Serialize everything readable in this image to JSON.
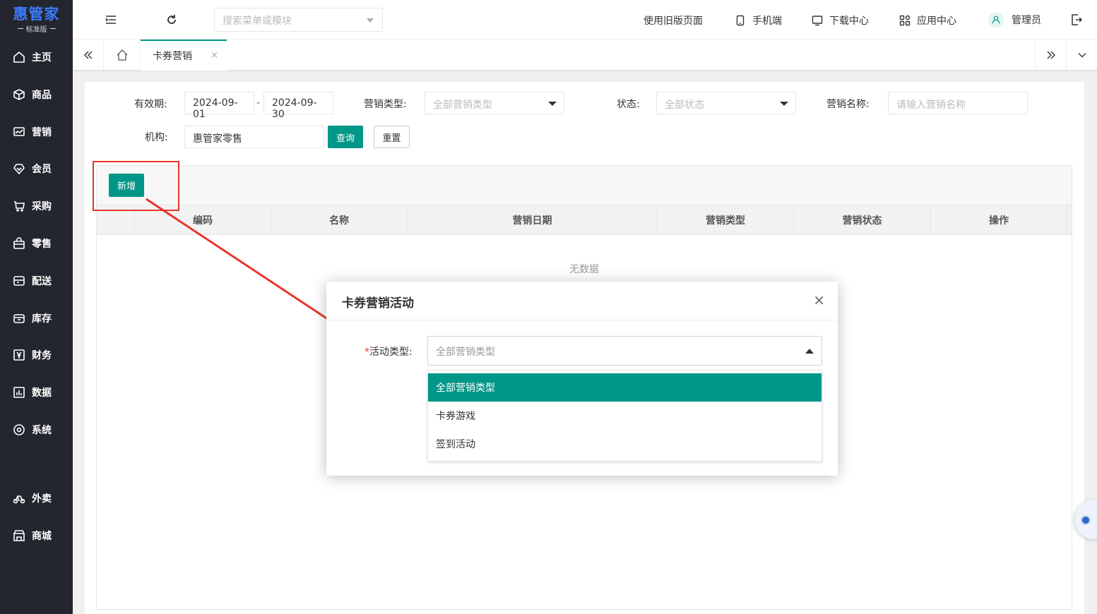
{
  "brand": {
    "name": "惠管家",
    "edition": "标准版",
    "color": "#3b7cff"
  },
  "sidebar": {
    "items": [
      {
        "label": "主页",
        "icon": "home-icon"
      },
      {
        "label": "商品",
        "icon": "cube-icon"
      },
      {
        "label": "营销",
        "icon": "chart-icon"
      },
      {
        "label": "会员",
        "icon": "diamond-icon"
      },
      {
        "label": "采购",
        "icon": "cart-icon"
      },
      {
        "label": "零售",
        "icon": "bag-icon"
      },
      {
        "label": "配送",
        "icon": "truck-icon"
      },
      {
        "label": "库存",
        "icon": "box-icon"
      },
      {
        "label": "财务",
        "icon": "yen-icon"
      },
      {
        "label": "数据",
        "icon": "bar-chart-icon"
      },
      {
        "label": "系统",
        "icon": "settings-icon"
      },
      {
        "label": "外卖",
        "icon": "bike-icon"
      },
      {
        "label": "商城",
        "icon": "store-icon"
      }
    ]
  },
  "header": {
    "search_placeholder": "搜索菜单或模块",
    "links": {
      "old_version": "使用旧版页面",
      "mobile": "手机端",
      "download": "下载中心",
      "apps": "应用中心",
      "user": "管理员"
    }
  },
  "tabs": {
    "active": "卡券营销",
    "close": "×"
  },
  "filters": {
    "validity_label": "有效期:",
    "date_from": "2024-09-01",
    "date_sep": "-",
    "date_to": "2024-09-30",
    "type_label": "营销类型:",
    "type_value": "全部营销类型",
    "status_label": "状态:",
    "status_value": "全部状态",
    "name_label": "营销名称:",
    "name_placeholder": "请输入营销名称",
    "org_label": "机构:",
    "org_value": "惠管家零售",
    "query_button": "查询",
    "reset_button": "重置"
  },
  "table": {
    "add_button": "新增",
    "columns": [
      "编码",
      "名称",
      "营销日期",
      "营销类型",
      "营销状态",
      "操作"
    ],
    "empty_text": "无数据"
  },
  "modal": {
    "title": "卡券营销活动",
    "close": "×",
    "field_required": "*",
    "field_label": "活动类型:",
    "field_placeholder": "全部营销类型",
    "options": [
      "全部营销类型",
      "卡券游戏",
      "签到活动"
    ],
    "selected_index": 0
  },
  "colors": {
    "accent": "#009688",
    "sidebar_bg": "#23262e",
    "annotation_red": "#e8352b"
  }
}
